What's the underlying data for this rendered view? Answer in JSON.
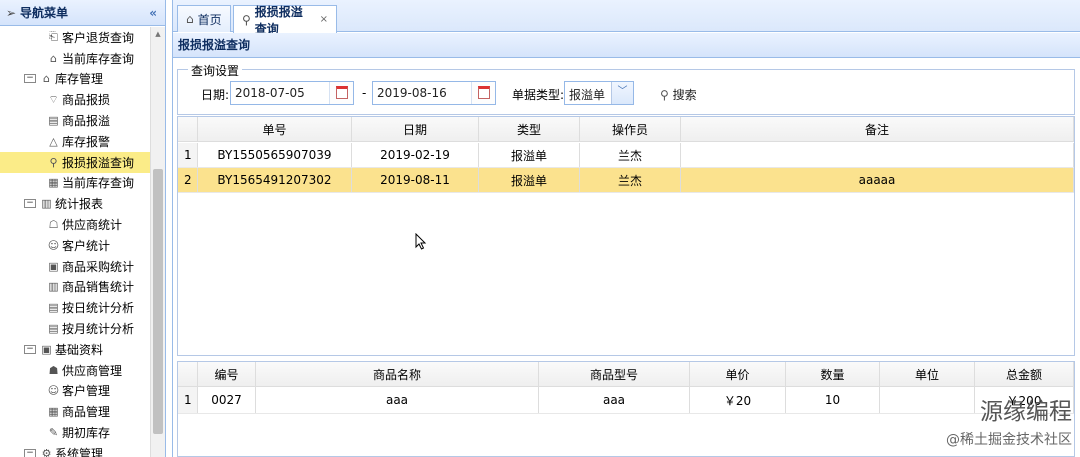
{
  "nav": {
    "title": "导航菜单",
    "collapse": "«",
    "items": [
      {
        "label": "客户退货查询",
        "level": 2,
        "icon": "document-return-icon",
        "glyph": "⎗"
      },
      {
        "label": "当前库存查询",
        "level": 2,
        "icon": "house-icon",
        "glyph": "⌂"
      },
      {
        "label": "库存管理",
        "level": 1,
        "icon": "home-icon",
        "glyph": "⌂",
        "expand": "−"
      },
      {
        "label": "商品报损",
        "level": 2,
        "icon": "broken-icon",
        "glyph": "⌔"
      },
      {
        "label": "商品报溢",
        "level": 2,
        "icon": "overflow-icon",
        "glyph": "▤"
      },
      {
        "label": "库存报警",
        "level": 2,
        "icon": "warning-icon",
        "glyph": "△"
      },
      {
        "label": "报损报溢查询",
        "level": 2,
        "icon": "search-icon",
        "glyph": "⚲",
        "selected": true
      },
      {
        "label": "当前库存查询",
        "level": 2,
        "icon": "grid-icon",
        "glyph": "▦"
      },
      {
        "label": "统计报表",
        "level": 1,
        "icon": "bar-chart-icon",
        "glyph": "▥",
        "expand": "−"
      },
      {
        "label": "供应商统计",
        "level": 2,
        "icon": "supplier-icon",
        "glyph": "☖"
      },
      {
        "label": "客户统计",
        "level": 2,
        "icon": "users-icon",
        "glyph": "☺"
      },
      {
        "label": "商品采购统计",
        "level": 2,
        "icon": "purchase-icon",
        "glyph": "▣"
      },
      {
        "label": "商品销售统计",
        "level": 2,
        "icon": "sales-chart-icon",
        "glyph": "▥"
      },
      {
        "label": "按日统计分析",
        "level": 2,
        "icon": "daily-report-icon",
        "glyph": "▤"
      },
      {
        "label": "按月统计分析",
        "level": 2,
        "icon": "monthly-report-icon",
        "glyph": "▤"
      },
      {
        "label": "基础资料",
        "level": 1,
        "icon": "book-icon",
        "glyph": "▣",
        "expand": "−"
      },
      {
        "label": "供应商管理",
        "level": 2,
        "icon": "supplier-manage-icon",
        "glyph": "☗"
      },
      {
        "label": "客户管理",
        "level": 2,
        "icon": "customer-manage-icon",
        "glyph": "☺"
      },
      {
        "label": "商品管理",
        "level": 2,
        "icon": "goods-manage-icon",
        "glyph": "▦"
      },
      {
        "label": "期初库存",
        "level": 2,
        "icon": "initial-stock-icon",
        "glyph": "✎"
      },
      {
        "label": "系统管理",
        "level": 1,
        "icon": "gear-icon",
        "glyph": "⚙",
        "expand": "−"
      }
    ]
  },
  "tabs": [
    {
      "label": "首页",
      "glyph": "⌂"
    },
    {
      "label": "报损报溢查询",
      "glyph": "⚲",
      "close": "×"
    }
  ],
  "panel": {
    "title": "报损报溢查询"
  },
  "query": {
    "legend": "查询设置",
    "date_label": "日期:",
    "date_from": "2018-07-05",
    "date_sep": "-",
    "date_to": "2019-08-16",
    "type_label": "单据类型:",
    "type_value": "报溢单",
    "search_label": "搜索"
  },
  "grid1": {
    "columns": [
      "",
      "单号",
      "日期",
      "类型",
      "操作员",
      "备注"
    ],
    "rows": [
      [
        "1",
        "BY1550565907039",
        "2019-02-19",
        "报溢单",
        "兰杰",
        ""
      ],
      [
        "2",
        "BY1565491207302",
        "2019-08-11",
        "报溢单",
        "兰杰",
        "aaaaa"
      ]
    ]
  },
  "grid2": {
    "columns": [
      "",
      "编号",
      "商品名称",
      "商品型号",
      "单价",
      "数量",
      "单位",
      "总金额"
    ],
    "rows": [
      [
        "1",
        "0027",
        "aaa",
        "aaa",
        "￥20",
        "10",
        "",
        "￥200"
      ]
    ]
  },
  "watermark": {
    "main": "源缘编程",
    "sub": "@稀土掘金技术社区"
  }
}
